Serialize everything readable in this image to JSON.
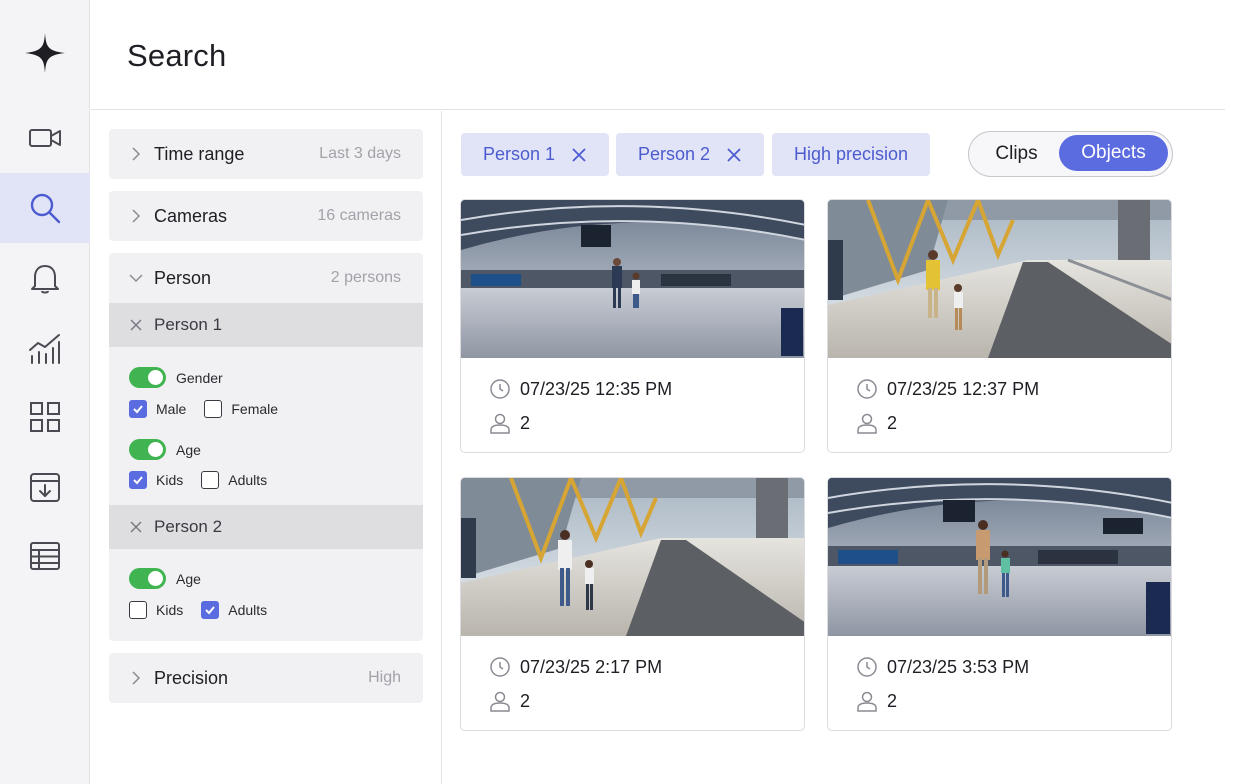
{
  "nav": {
    "items": [
      "camera-icon",
      "search-icon",
      "bell-icon",
      "analytics-icon",
      "grid-icon",
      "download-icon",
      "table-icon"
    ],
    "active": "search-icon"
  },
  "header": {
    "title": "Search"
  },
  "filters": {
    "time_range": {
      "label": "Time range",
      "value": "Last 3 days"
    },
    "cameras": {
      "label": "Cameras",
      "value": "16 cameras"
    },
    "person": {
      "label": "Person",
      "value": "2 persons",
      "persons": [
        {
          "label": "Person 1",
          "groups": [
            {
              "label": "Gender",
              "enabled": true,
              "options": [
                {
                  "label": "Male",
                  "checked": true
                },
                {
                  "label": "Female",
                  "checked": false
                }
              ]
            },
            {
              "label": "Age",
              "enabled": true,
              "options": [
                {
                  "label": "Kids",
                  "checked": true
                },
                {
                  "label": "Adults",
                  "checked": false
                }
              ]
            }
          ]
        },
        {
          "label": "Person 2",
          "groups": [
            {
              "label": "Age",
              "enabled": true,
              "options": [
                {
                  "label": "Kids",
                  "checked": false
                },
                {
                  "label": "Adults",
                  "checked": true
                }
              ]
            }
          ]
        }
      ]
    },
    "precision": {
      "label": "Precision",
      "value": "High"
    }
  },
  "chips": [
    "Person 1",
    "Person 2",
    "High precision"
  ],
  "view_toggle": {
    "clips": "Clips",
    "objects": "Objects",
    "selected": "Objects"
  },
  "results": [
    {
      "timestamp": "07/23/25 12:35 PM",
      "count": "2"
    },
    {
      "timestamp": "07/23/25 12:37 PM",
      "count": "2"
    },
    {
      "timestamp": "07/23/25 2:17 PM",
      "count": "2"
    },
    {
      "timestamp": "07/23/25 3:53 PM",
      "count": "2"
    }
  ],
  "colors": {
    "accent": "#5b6be0",
    "chip_bg": "#e1e4f7",
    "toggle_on": "#3fb451",
    "rail_bg": "#f4f4f6"
  }
}
